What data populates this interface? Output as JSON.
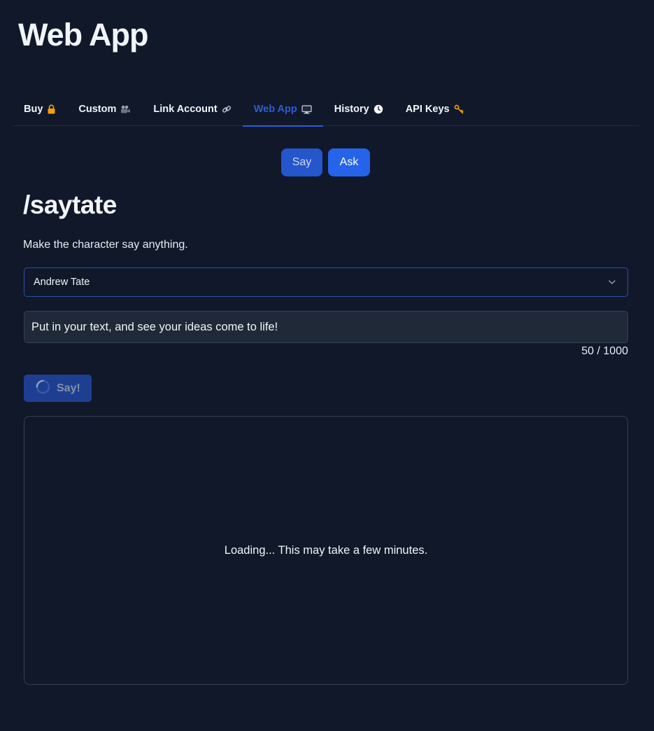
{
  "app": {
    "title": "Web App"
  },
  "tabs": [
    {
      "label": "Buy",
      "icon": "lock-icon",
      "glyph": "🔒",
      "active": false
    },
    {
      "label": "Custom",
      "icon": "video-camera-icon",
      "glyph": "📹",
      "active": false
    },
    {
      "label": "Link Account",
      "icon": "link-icon",
      "glyph": "🔗",
      "active": false
    },
    {
      "label": "Web App",
      "icon": "monitor-icon",
      "glyph": "🖥",
      "active": true
    },
    {
      "label": "History",
      "icon": "clock-icon",
      "glyph": "🕐",
      "active": false
    },
    {
      "label": "API Keys",
      "icon": "key-icon",
      "glyph": "🔑",
      "active": false
    }
  ],
  "mode": {
    "say_label": "Say",
    "ask_label": "Ask"
  },
  "command": {
    "title": "/saytate",
    "description": "Make the character say anything."
  },
  "character_select": {
    "selected": "Andrew Tate"
  },
  "text_input": {
    "value": "Put in your text, and see your ideas come to life!",
    "counter": "50 / 1000"
  },
  "submit": {
    "label": "Say!",
    "state": "loading"
  },
  "output": {
    "status": "Loading... This may take a few minutes."
  },
  "colors": {
    "background": "#10182a",
    "accent": "#2563eb",
    "active_tab": "#2f5bd6"
  }
}
